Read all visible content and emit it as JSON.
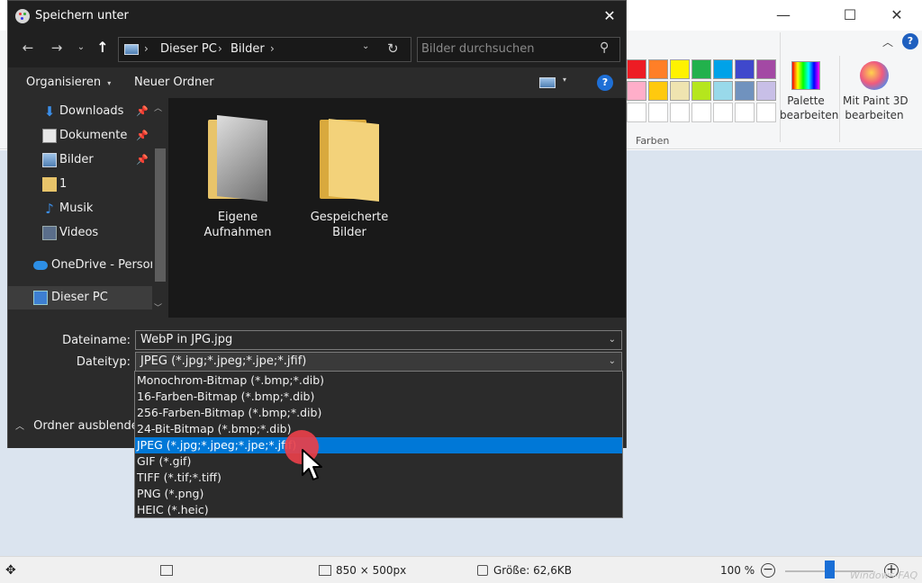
{
  "paint": {
    "colors_group_label": "Farben",
    "edit_colors_label": "Palette\nbearbeiten",
    "paint3d_label": "Mit Paint 3D\nbearbeiten",
    "palette_row1": [
      "#ed1c24",
      "#ff7f27",
      "#fff200",
      "#22b14c",
      "#00a2e8",
      "#3f48cc",
      "#a349a4"
    ],
    "palette_row2": [
      "#ffaec9",
      "#ffc90e",
      "#efe4b0",
      "#b5e61d",
      "#99d9ea",
      "#7092be",
      "#c8bfe7"
    ],
    "status": {
      "dimensions": "850 × 500px",
      "size": "Größe: 62,6KB",
      "zoom": "100 %"
    },
    "watermark": "Windows-FAQ"
  },
  "dialog": {
    "title": "Speichern unter",
    "breadcrumb": [
      "Dieser PC",
      "Bilder"
    ],
    "search_placeholder": "Bilder durchsuchen",
    "organize": "Organisieren",
    "new_folder": "Neuer Ordner",
    "sidebar": [
      {
        "label": "Downloads",
        "icon": "download-icon",
        "pinned": true
      },
      {
        "label": "Dokumente",
        "icon": "document-icon",
        "pinned": true
      },
      {
        "label": "Bilder",
        "icon": "pictures-icon",
        "pinned": true
      },
      {
        "label": "1",
        "icon": "folder-icon",
        "pinned": false
      },
      {
        "label": "Musik",
        "icon": "music-icon",
        "pinned": false
      },
      {
        "label": "Videos",
        "icon": "videos-icon",
        "pinned": false
      },
      {
        "label": "OneDrive - Person",
        "icon": "onedrive-icon",
        "pinned": false
      },
      {
        "label": "Dieser PC",
        "icon": "computer-icon",
        "pinned": false
      }
    ],
    "folders": [
      {
        "name": "Eigene Aufnahmen"
      },
      {
        "name": "Gespeicherte Bilder"
      }
    ],
    "filename_label": "Dateiname:",
    "filename_value": "WebP in JPG.jpg",
    "filetype_label": "Dateityp:",
    "filetype_value": "JPEG (*.jpg;*.jpeg;*.jpe;*.jfif)",
    "hide_folders": "Ordner ausblenden",
    "filetype_options": [
      "Monochrom-Bitmap (*.bmp;*.dib)",
      "16-Farben-Bitmap (*.bmp;*.dib)",
      "256-Farben-Bitmap (*.bmp;*.dib)",
      "24-Bit-Bitmap (*.bmp;*.dib)",
      "JPEG (*.jpg;*.jpeg;*.jpe;*.jfif)",
      "GIF (*.gif)",
      "TIFF (*.tif;*.tiff)",
      "PNG (*.png)",
      "HEIC (*.heic)"
    ],
    "selected_option_index": 4
  },
  "colors": {
    "dialog_bg": "#202020",
    "selection": "#0078d7",
    "cursor_highlight": "#e8404a"
  }
}
